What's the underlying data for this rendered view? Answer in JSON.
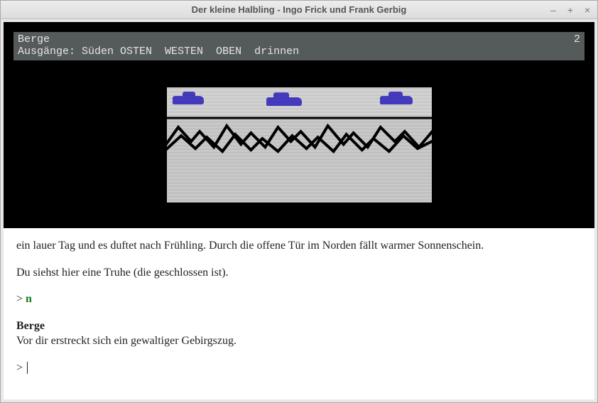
{
  "window": {
    "title": "Der kleine Halbling - Ingo Frick und Frank Gerbig"
  },
  "status": {
    "location": "Berge",
    "score": "2",
    "exits_label": "Ausgänge:",
    "exits": "Süden OSTEN  WESTEN  OBEN  drinnen"
  },
  "illustration": {
    "alt": "Retro pixel mountains with purple clouds"
  },
  "story": {
    "p1": "ein lauer Tag und es duftet nach Frühling. Durch die offene Tür im Norden fällt warmer Sonnenschein.",
    "p2": "Du siehst hier eine Truhe (die geschlossen ist).",
    "prompt1_symbol": ">",
    "prompt1_cmd": "n",
    "heading": "Berge",
    "p3": "Vor dir erstreckt sich ein gewaltiger Gebirgszug.",
    "prompt2_symbol": ">"
  }
}
